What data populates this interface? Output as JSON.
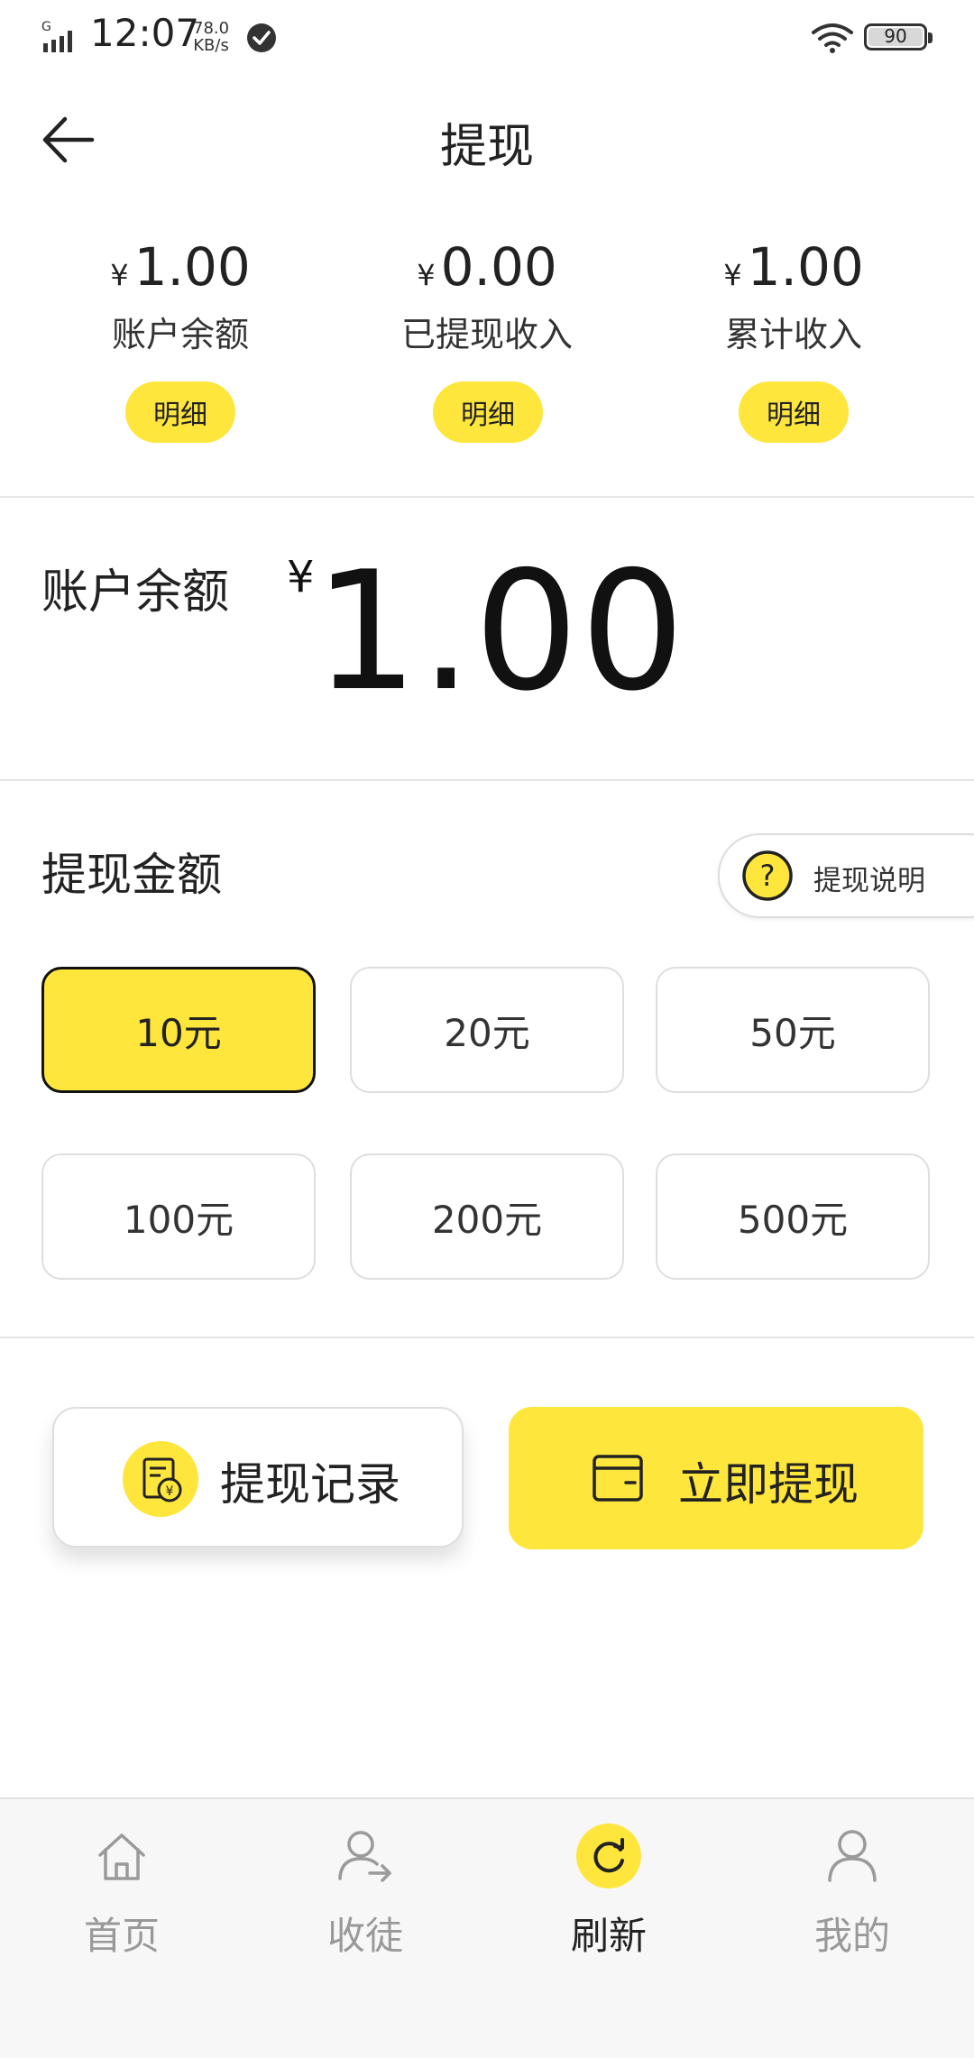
{
  "status_bar": {
    "time": "12:07",
    "net_speed_value": "78.0",
    "net_speed_unit": "KB/s",
    "battery": "90"
  },
  "topbar": {
    "title": "提现",
    "back_icon": "arrow-left-icon"
  },
  "summary": [
    {
      "currency": "¥",
      "amount": "1.00",
      "label": "账户余额",
      "detail_label": "明细"
    },
    {
      "currency": "¥",
      "amount": "0.00",
      "label": "已提现收入",
      "detail_label": "明细"
    },
    {
      "currency": "¥",
      "amount": "1.00",
      "label": "累计收入",
      "detail_label": "明细"
    }
  ],
  "balance": {
    "label": "账户余额",
    "currency": "¥",
    "amount": "1.00"
  },
  "withdraw_amount": {
    "label": "提现金额",
    "explain_label": "提现说明",
    "explain_icon": "question-icon",
    "options": [
      "10元",
      "20元",
      "50元",
      "100元",
      "200元",
      "500元"
    ],
    "selected": "10元"
  },
  "actions": {
    "record_label": "提现记录",
    "record_icon": "receipt-yen-icon",
    "withdraw_label": "立即提现",
    "withdraw_icon": "wallet-icon"
  },
  "tabbar": [
    {
      "label": "首页",
      "icon": "home-icon",
      "active": false
    },
    {
      "label": "收徒",
      "icon": "user-arrow-icon",
      "active": false
    },
    {
      "label": "刷新",
      "icon": "refresh-icon",
      "active": true
    },
    {
      "label": "我的",
      "icon": "user-icon",
      "active": false
    }
  ],
  "colors": {
    "accent": "#FFE63C",
    "text": "#222222",
    "muted": "#999999",
    "divider": "#E6E6E6"
  }
}
